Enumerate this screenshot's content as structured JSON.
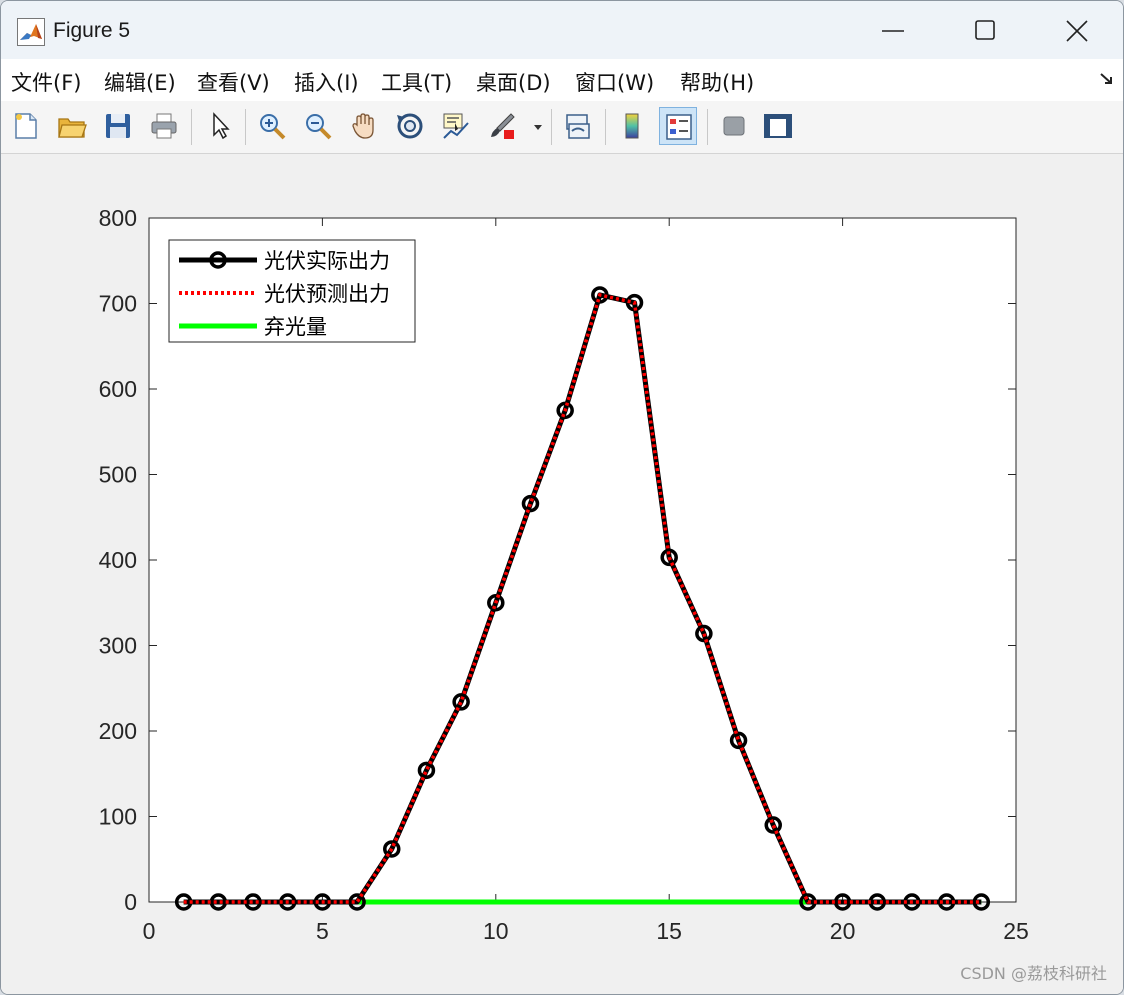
{
  "window": {
    "title": "Figure 5",
    "controls": {
      "minimize": "minimize-icon",
      "maximize": "maximize-icon",
      "close": "close-icon"
    }
  },
  "menu": [
    "文件(F)",
    "编辑(E)",
    "查看(V)",
    "插入(I)",
    "工具(T)",
    "桌面(D)",
    "窗口(W)",
    "帮助(H)"
  ],
  "toolbar": [
    "new-figure-icon",
    "open-file-icon",
    "save-icon",
    "print-icon",
    "select-arrow-icon",
    "zoom-in-icon",
    "zoom-out-icon",
    "pan-hand-icon",
    "rotate-3d-icon",
    "data-cursor-icon",
    "brush-icon",
    "link-plot-icon",
    "colorbar-icon",
    "legend-icon",
    "hide-plot-tools-icon",
    "show-plot-tools-icon"
  ],
  "chart_data": {
    "type": "line",
    "xlim": [
      0,
      25
    ],
    "ylim": [
      0,
      800
    ],
    "xticks": [
      0,
      5,
      10,
      15,
      20,
      25
    ],
    "yticks": [
      0,
      100,
      200,
      300,
      400,
      500,
      600,
      700,
      800
    ],
    "legend_position": "top-left",
    "x": [
      1,
      2,
      3,
      4,
      5,
      6,
      7,
      8,
      9,
      10,
      11,
      12,
      13,
      14,
      15,
      16,
      17,
      18,
      19,
      20,
      21,
      22,
      23,
      24
    ],
    "series": [
      {
        "name": "光伏实际出力",
        "color": "#000000",
        "style": "solid-circle-markers",
        "values": [
          0,
          0,
          0,
          0,
          0,
          0,
          62,
          154,
          234,
          350,
          466,
          575,
          710,
          701,
          403,
          314,
          189,
          90,
          0,
          0,
          0,
          0,
          0,
          0
        ]
      },
      {
        "name": "光伏预测出力",
        "color": "#ff0000",
        "style": "dotted",
        "values": [
          0,
          0,
          0,
          0,
          0,
          0,
          62,
          154,
          234,
          350,
          466,
          575,
          710,
          701,
          403,
          314,
          189,
          90,
          0,
          0,
          0,
          0,
          0,
          0
        ]
      },
      {
        "name": "弃光量",
        "color": "#00ff00",
        "style": "solid",
        "values": [
          0,
          0,
          0,
          0,
          0,
          0,
          0,
          0,
          0,
          0,
          0,
          0,
          0,
          0,
          0,
          0,
          0,
          0,
          0,
          0,
          0,
          0,
          0,
          0
        ]
      }
    ]
  },
  "watermark": "CSDN @荔枝科研社"
}
